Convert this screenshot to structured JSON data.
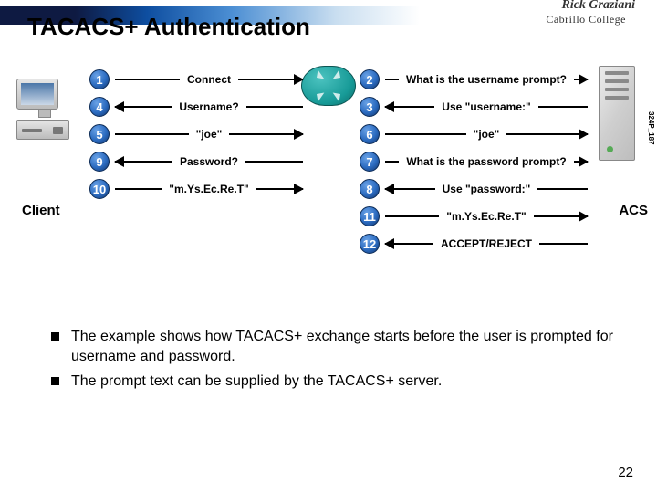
{
  "header": {
    "title": "TACACS+ Authentication",
    "author": "Rick Graziani",
    "college": "Cabrillo College"
  },
  "labels": {
    "client": "Client",
    "acs": "ACS",
    "side_id": "324P_187"
  },
  "left_flows": [
    {
      "n": "1",
      "label": "Connect",
      "dir": "right"
    },
    {
      "n": "4",
      "label": "Username?",
      "dir": "left"
    },
    {
      "n": "5",
      "label": "\"joe\"",
      "dir": "right"
    },
    {
      "n": "9",
      "label": "Password?",
      "dir": "left"
    },
    {
      "n": "10",
      "label": "\"m.Ys.Ec.Re.T\"",
      "dir": "right"
    }
  ],
  "right_flows": [
    {
      "n": "2",
      "label": "What is the username prompt?",
      "dir": "right"
    },
    {
      "n": "3",
      "label": "Use \"username:\"",
      "dir": "left"
    },
    {
      "n": "6",
      "label": "\"joe\"",
      "dir": "right"
    },
    {
      "n": "7",
      "label": "What is the password prompt?",
      "dir": "right"
    },
    {
      "n": "8",
      "label": "Use \"password:\"",
      "dir": "left"
    },
    {
      "n": "11",
      "label": "\"m.Ys.Ec.Re.T\"",
      "dir": "right"
    },
    {
      "n": "12",
      "label": "ACCEPT/REJECT",
      "dir": "left"
    }
  ],
  "bullets": [
    "The example shows how TACACS+ exchange starts before the user is prompted for username and password.",
    "The prompt text can be supplied by the TACACS+ server."
  ],
  "page_number": "22"
}
